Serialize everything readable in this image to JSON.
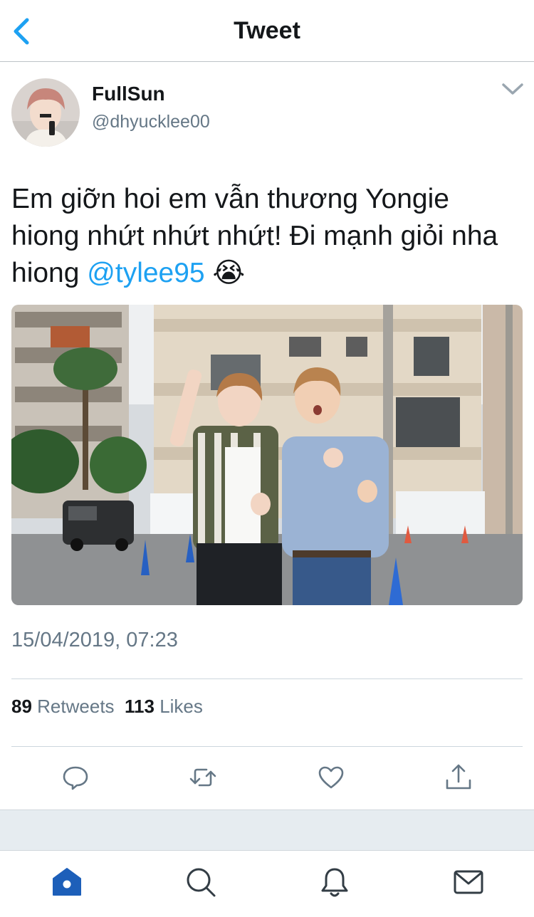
{
  "nav": {
    "title": "Tweet",
    "back_icon": "chevron-left-icon"
  },
  "colors": {
    "accent": "#1da1f2",
    "text_primary": "#14171a",
    "text_secondary": "#657786",
    "divider": "#ccd6dd",
    "gap": "#e6ecf0"
  },
  "tweet": {
    "author": {
      "display_name": "FullSun",
      "username": "@dhyucklee00"
    },
    "menu_icon": "chevron-down-icon",
    "text_before_mention": "Em giỡn hoi em vẫn thương Yongie hiong nhứt nhứt nhứt! Đi mạnh giỏi nha hiong ",
    "mention": "@tylee95",
    "emoji": "😭",
    "photo_icon": "photo",
    "timestamp": "15/04/2019, 07:23",
    "stats": {
      "retweets_count": "89",
      "retweets_label": "Retweets",
      "likes_count": "113",
      "likes_label": "Likes"
    },
    "actions": [
      {
        "name": "reply",
        "icon": "reply-icon"
      },
      {
        "name": "retweet",
        "icon": "retweet-icon"
      },
      {
        "name": "like",
        "icon": "heart-icon"
      },
      {
        "name": "share",
        "icon": "share-icon"
      }
    ]
  },
  "tab_bar": {
    "tabs": [
      {
        "name": "home",
        "icon": "home-icon",
        "active": true
      },
      {
        "name": "search",
        "icon": "search-icon",
        "active": false
      },
      {
        "name": "notifications",
        "icon": "bell-icon",
        "active": false
      },
      {
        "name": "messages",
        "icon": "mail-icon",
        "active": false
      }
    ]
  }
}
